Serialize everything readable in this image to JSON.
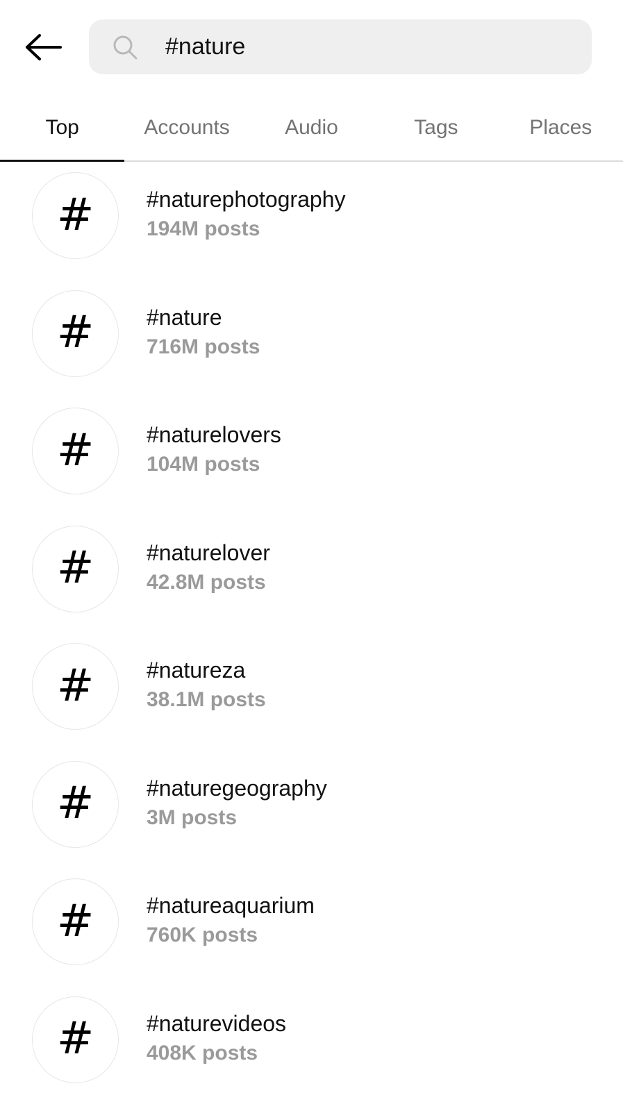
{
  "search": {
    "query": "#nature"
  },
  "icons": {
    "back": "arrow-left-icon",
    "search": "search-icon",
    "hashtag": "hashtag-icon"
  },
  "tabs": [
    {
      "label": "Top",
      "active": true
    },
    {
      "label": "Accounts",
      "active": false
    },
    {
      "label": "Audio",
      "active": false
    },
    {
      "label": "Tags",
      "active": false
    },
    {
      "label": "Places",
      "active": false
    }
  ],
  "results": [
    {
      "tag": "#naturephotography",
      "count": "194M posts"
    },
    {
      "tag": "#nature",
      "count": "716M posts"
    },
    {
      "tag": "#naturelovers",
      "count": "104M posts"
    },
    {
      "tag": "#naturelover",
      "count": "42.8M posts"
    },
    {
      "tag": "#natureza",
      "count": "38.1M posts"
    },
    {
      "tag": "#naturegeography",
      "count": "3M posts"
    },
    {
      "tag": "#natureaquarium",
      "count": "760K posts"
    },
    {
      "tag": "#naturevideos",
      "count": "408K posts"
    }
  ],
  "colors": {
    "search_bg": "#efefef",
    "primary_text": "#111111",
    "secondary_text": "#9a9a9a",
    "tab_inactive": "#737373",
    "divider": "#dbdbdb"
  }
}
